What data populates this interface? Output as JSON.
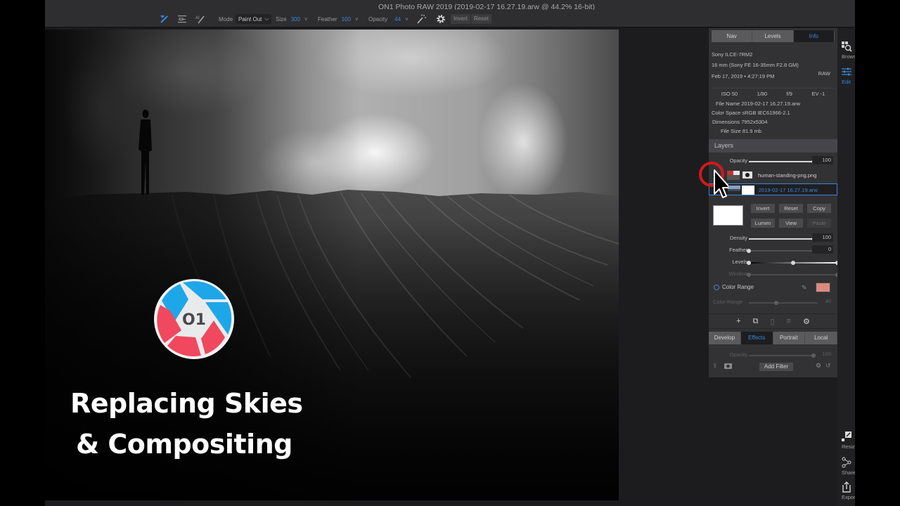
{
  "window": {
    "title": "ON1 Photo RAW 2019 (2019-02-17 16.27.19.arw @ 44.2% 16-bit)"
  },
  "toolbar": {
    "tools": [
      {
        "icon": "masking-brush-icon",
        "active": true
      },
      {
        "icon": "gradient-mask-icon",
        "active": false
      },
      {
        "icon": "ai-quick-mask-icon",
        "active": false
      }
    ],
    "mode": {
      "label": "Mode",
      "value": "Paint Out"
    },
    "size": {
      "label": "Size",
      "value": "300"
    },
    "feather": {
      "label": "Feather",
      "value": "100"
    },
    "opacity": {
      "label": "Opacity",
      "value": "44"
    },
    "invert_label": "Invert",
    "reset_label": "Reset"
  },
  "overlay": {
    "logo_text": "O1",
    "headline_line1": "Replacing Skies",
    "headline_line2": "& Compositing",
    "colors": {
      "blue": "#1ea7e8",
      "red": "#f0485e"
    }
  },
  "panel": {
    "tabs": [
      {
        "label": "Nav",
        "active": false
      },
      {
        "label": "Levels",
        "active": false
      },
      {
        "label": "Info",
        "active": true
      }
    ],
    "info": {
      "camera": "Sony ILCE-7RM2",
      "lens": "16 mm (Sony FE 16-35mm F2.8 GM)",
      "datetime": "Feb 17, 2019 • 4:27:19 PM",
      "format": "RAW",
      "iso": "ISO 50",
      "shutter": "1/80",
      "aperture": "f/9",
      "ev": "EV -1",
      "file_name": "File Name 2019-02-17 16.27.19.arw",
      "color_space": "Color Space sRGB IEC61966-2.1",
      "dimensions": "Dimensions 7952x5304",
      "file_size": "File Size 81.9 mb"
    },
    "layers": {
      "title": "Layers",
      "opacity": {
        "label": "Opacity",
        "value": "100",
        "fraction": 1.0
      },
      "items": [
        {
          "name": "human-standing-png.png",
          "selected": false
        },
        {
          "name": "2019-02-17 16.27.19.arw",
          "selected": true
        }
      ]
    },
    "mask_buttons": {
      "invert": "Invert",
      "reset": "Reset",
      "copy": "Copy",
      "lumen": "Lumen",
      "view": "View",
      "paste": "Paste"
    },
    "mask_sliders": {
      "density": {
        "label": "Density",
        "value": "100",
        "fraction": 1.0
      },
      "feather": {
        "label": "Feather",
        "value": "0",
        "fraction": 0.0
      },
      "levels": {
        "label": "Levels",
        "black": 0.0,
        "mid": 0.5,
        "white": 1.0
      },
      "window": {
        "label": "Window"
      }
    },
    "color_range": {
      "label": "Color Range",
      "swatch": "#d98b7e",
      "slider_label": "Color Range",
      "value": "40",
      "fraction": 0.4
    },
    "module_tabs": [
      {
        "label": "Develop",
        "active": false
      },
      {
        "label": "Effects",
        "active": true
      },
      {
        "label": "Portrait",
        "active": false
      },
      {
        "label": "Local",
        "active": false
      }
    ],
    "effects": {
      "opacity": {
        "label": "Opacity",
        "value": "100",
        "fraction": 1.0
      },
      "add_filter_label": "Add Filter"
    }
  },
  "right_strip": {
    "top": [
      {
        "label": "Browse",
        "icon": "browse-icon",
        "active": false
      },
      {
        "label": "Edit",
        "icon": "edit-sliders-icon",
        "active": true
      }
    ],
    "bottom": [
      {
        "label": "Resize",
        "icon": "resize-icon"
      },
      {
        "label": "Share",
        "icon": "share-icon"
      },
      {
        "label": "Export",
        "icon": "export-icon"
      }
    ]
  }
}
